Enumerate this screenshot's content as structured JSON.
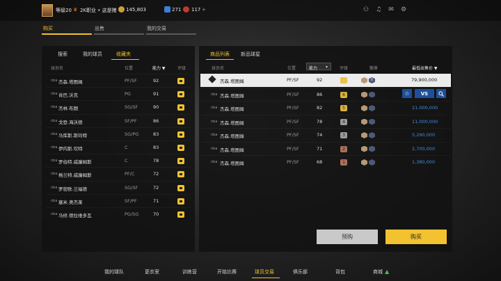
{
  "topbar": {
    "level": "等级20",
    "career": "2K职业 • 这是猪",
    "currency": "145,803",
    "stat1": "271",
    "stat2": "117"
  },
  "main_tabs": [
    {
      "label": "购买",
      "active": true
    },
    {
      "label": "出售",
      "active": false
    },
    {
      "label": "我的交易",
      "active": false
    }
  ],
  "left_panel": {
    "subtabs": [
      {
        "label": "搜索",
        "active": false
      },
      {
        "label": "我的球员",
        "active": false
      },
      {
        "label": "收藏夹",
        "active": true
      }
    ],
    "headers": {
      "name": "球员名",
      "position": "位置",
      "rating": "能力 ▼",
      "tier": "评级"
    },
    "rows": [
      {
        "name": "杰森.塔图姆",
        "position": "PF/SF",
        "rating": "92"
      },
      {
        "name": "肯巴.沃克",
        "position": "PG",
        "rating": "91"
      },
      {
        "name": "杰林.布朗",
        "position": "SG/SF",
        "rating": "90"
      },
      {
        "name": "戈登.海沃德",
        "position": "SF/PF",
        "rating": "86"
      },
      {
        "name": "马库斯.斯玛特",
        "position": "SG/PG",
        "rating": "83"
      },
      {
        "name": "伊内斯.坎特",
        "position": "C",
        "rating": "83"
      },
      {
        "name": "罗伯特.威廉姆斯",
        "position": "C",
        "rating": "78"
      },
      {
        "name": "格兰特.威廉姆斯",
        "position": "PF/C",
        "rating": "72"
      },
      {
        "name": "罗密欧.兰福德",
        "position": "SG/SF",
        "rating": "72"
      },
      {
        "name": "塞米.奥杰莱",
        "position": "SF/PF",
        "rating": "71"
      },
      {
        "name": "马修.德拉维多瓦",
        "position": "PG/SG",
        "rating": "70"
      }
    ]
  },
  "right_panel": {
    "subtabs": [
      {
        "label": "商品列表",
        "active": true
      },
      {
        "label": "新品球星",
        "active": false
      }
    ],
    "headers": {
      "name": "球员名",
      "position": "位置",
      "rating": "能力",
      "tier": "评级",
      "badge": "徽章",
      "price": "最低出售价 ▼"
    },
    "rows": [
      {
        "name": "杰森.塔图姆",
        "position": "PF/SF",
        "rating": "92",
        "tier_color": "#e9c34a",
        "tier_label": "",
        "badge_num": "8",
        "price": "79,900,000",
        "selected": true
      },
      {
        "name": "杰森.塔图姆",
        "position": "PF/SF",
        "rating": "86",
        "tier_color": "#d9b23a",
        "tier_label": "6",
        "badge_num": "",
        "price": "",
        "selected": false
      },
      {
        "name": "杰森.塔图姆",
        "position": "PF/SF",
        "rating": "82",
        "tier_color": "#d9b23a",
        "tier_label": "5",
        "badge_num": "",
        "price": "21,000,000",
        "selected": false
      },
      {
        "name": "杰森.塔图姆",
        "position": "PF/SF",
        "rating": "78",
        "tier_color": "#9a9a9a",
        "tier_label": "4",
        "badge_num": "",
        "price": "11,000,000",
        "selected": false
      },
      {
        "name": "杰森.塔图姆",
        "position": "PF/SF",
        "rating": "74",
        "tier_color": "#9a9a9a",
        "tier_label": "3",
        "badge_num": "",
        "price": "5,290,000",
        "selected": false
      },
      {
        "name": "杰森.塔图姆",
        "position": "PF/SF",
        "rating": "71",
        "tier_color": "#a8705a",
        "tier_label": "2",
        "badge_num": "",
        "price": "2,700,000",
        "selected": false
      },
      {
        "name": "杰森.塔图姆",
        "position": "PF/SF",
        "rating": "68",
        "tier_color": "#a8705a",
        "tier_label": "1",
        "badge_num": "",
        "price": "1,380,000",
        "selected": false
      }
    ],
    "action_icons": {
      "star": "☆",
      "vs": "VS",
      "search": "🔍"
    },
    "buttons": {
      "preorder": "预购",
      "buy": "购买"
    }
  },
  "bottom_nav": [
    {
      "label": "我的球队",
      "active": false
    },
    {
      "label": "更衣室",
      "active": false
    },
    {
      "label": "训练营",
      "active": false
    },
    {
      "label": "开始比赛",
      "active": false
    },
    {
      "label": "球员交易",
      "active": true
    },
    {
      "label": "俱乐部",
      "active": false
    },
    {
      "label": "背包",
      "active": false
    },
    {
      "label": "商城",
      "active": false
    }
  ],
  "colors": {
    "accent": "#f2c230",
    "price_blue": "#3f8fe0"
  }
}
